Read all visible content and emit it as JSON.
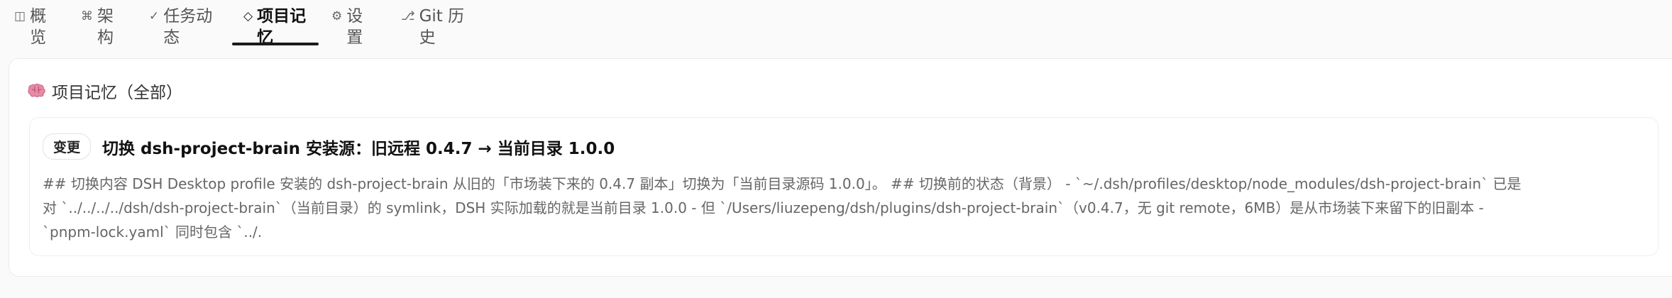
{
  "tabs": [
    {
      "icon": "◫",
      "label": "概览",
      "active": false
    },
    {
      "icon": "⌘",
      "label": "架构",
      "active": false
    },
    {
      "icon": "✓",
      "label": "任务动态",
      "active": false
    },
    {
      "icon": "◇",
      "label": "项目记忆",
      "active": true
    },
    {
      "icon": "⚙",
      "label": "设置",
      "active": false
    },
    {
      "icon": "⎇",
      "label": "Git 历史",
      "active": false
    }
  ],
  "panel": {
    "title": "项目记忆（全部）",
    "icon": "brain-icon"
  },
  "memory_card": {
    "badge": "变更",
    "title": "切换 dsh-project-brain 安装源：旧远程 0.4.7 → 当前目录 1.0.0",
    "body_line1": "## 切换内容 DSH Desktop profile 安装的 dsh-project-brain 从旧的「市场装下来的 0.4.7 副本」切换为「当前目录源码 1.0.0」。 ## 切换前的状态（背景） - `~/.dsh/profiles/desktop/node_modules/dsh-project-brain` 已是",
    "body_line2": "对 `../../../../dsh/dsh-project-brain`（当前目录）的 symlink，DSH 实际加载的就是当前目录 1.0.0 - 但 `/Users/liuzepeng/dsh/plugins/dsh-project-brain`（v0.4.7，无 git remote，6MB）是从市场装下来留下的旧副本 -",
    "body_line3": "`pnpm-lock.yaml` 同时包含 `../."
  },
  "colors": {
    "accent": "#1a1a1a",
    "muted_text": "#666666",
    "panel_bg": "#ffffff",
    "page_bg": "#fafafa",
    "brain_pink": "#e88aa6"
  }
}
